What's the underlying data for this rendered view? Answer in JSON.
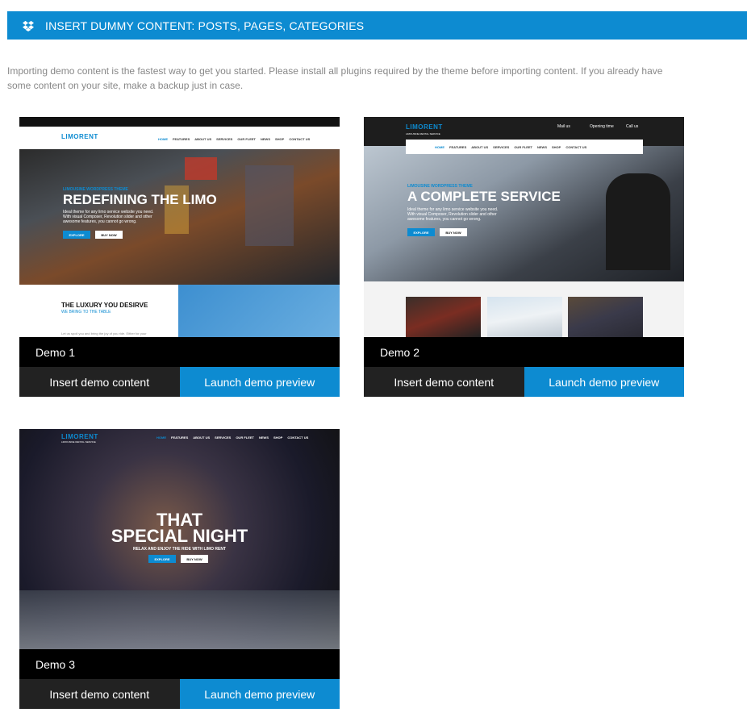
{
  "header": {
    "title": "INSERT DUMMY CONTENT: POSTS, PAGES, CATEGORIES",
    "icon": "dropbox-icon"
  },
  "intro": "Importing demo content is the fastest way to get you started. Please install all plugins required by the theme before importing content. If you already have some content on your site, make a backup just in case.",
  "colors": {
    "accent": "#0d8bd1",
    "dark_button": "#222222",
    "label_bg": "#000000"
  },
  "demos": [
    {
      "label": "Demo 1",
      "insert_label": "Insert demo content",
      "launch_label": "Launch demo preview",
      "preview": {
        "logo": "LIMORENT",
        "nav": [
          "HOME",
          "FEATURES",
          "ABOUT US",
          "SERVICES",
          "OUR FLEET",
          "NEWS",
          "SHOP",
          "CONTACT US"
        ],
        "kicker": "LIMOUSINE WORDPRESS THEME",
        "headline": "REDEFINING THE LIMO",
        "body": "Ideal theme for any limo service website you need. With visual Composer, Revolution slider and other awesome features, you cannot go wrong.",
        "explore": "EXPLORE",
        "buy": "BUY NOW",
        "section_title": "THE LUXURY YOU DESIRVE",
        "section_sub": "WE BRING TO THE TABLE",
        "section_text": "Let us spoil you and bring the joy of you ride. Either for your"
      }
    },
    {
      "label": "Demo 2",
      "insert_label": "Insert demo content",
      "launch_label": "Launch demo preview",
      "preview": {
        "logo": "LIMORENT",
        "tagline": "LIMOUSINE RENTAL SERVICE",
        "contact": [
          "Mail us",
          "Opening time",
          "Call us"
        ],
        "nav": [
          "HOME",
          "FEATURES",
          "ABOUT US",
          "SERVICES",
          "OUR FLEET",
          "NEWS",
          "SHOP",
          "CONTACT US"
        ],
        "kicker": "LIMOUSINE WORDPRESS THEME",
        "headline": "A COMPLETE SERVICE",
        "body": "Ideal theme for any limo service website you need. With visual Composer, Revolution slider and other awesome features, you cannot go wrong.",
        "explore": "EXPLORE",
        "buy": "BUY NOW"
      }
    },
    {
      "label": "Demo 3",
      "insert_label": "Insert demo content",
      "launch_label": "Launch demo preview",
      "preview": {
        "logo": "LIMORENT",
        "tagline": "LIMOUSINE RENTAL SERVICE",
        "nav": [
          "HOME",
          "FEATURES",
          "ABOUT US",
          "SERVICES",
          "OUR FLEET",
          "NEWS",
          "SHOP",
          "CONTACT US"
        ],
        "headline_1": "THAT",
        "headline_2": "SPECIAL NIGHT",
        "sub": "RELAX AND ENJOY THE RIDE WITH LIMO RENT",
        "explore": "EXPLORE",
        "buy": "BUY NOW"
      }
    }
  ]
}
